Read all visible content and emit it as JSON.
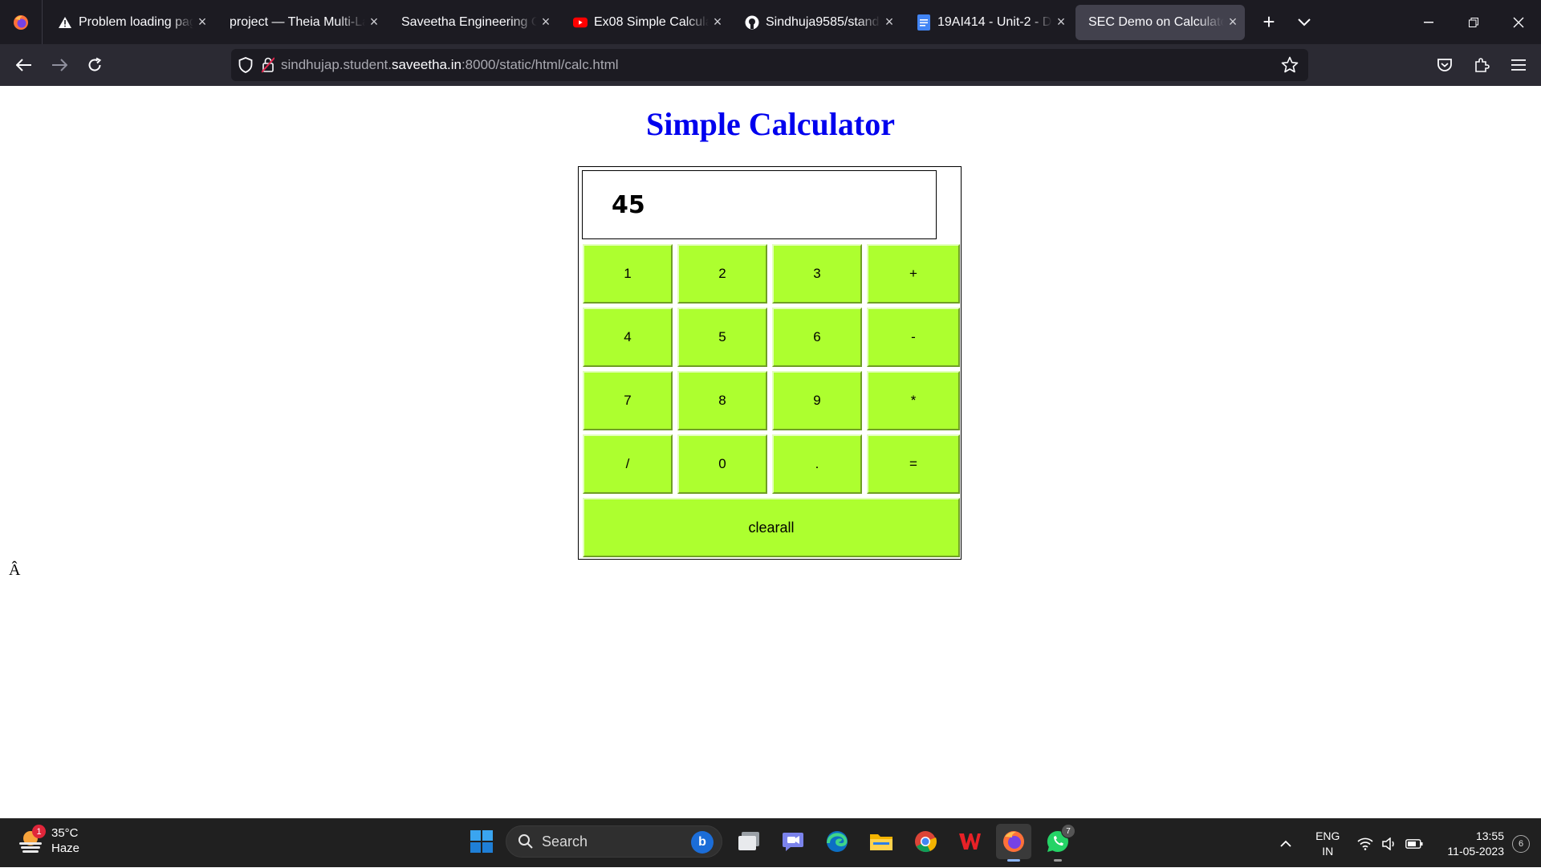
{
  "browser": {
    "tabs": [
      {
        "title": "Problem loading page",
        "icon": "warning-icon",
        "active": false
      },
      {
        "title": "project — Theia Multi-Language",
        "icon": "none",
        "active": false
      },
      {
        "title": "Saveetha Engineering College",
        "icon": "none",
        "active": false
      },
      {
        "title": "Ex08 Simple Calculator",
        "icon": "youtube-icon",
        "active": false
      },
      {
        "title": "Sindhuja9585/standard",
        "icon": "github-icon",
        "active": false
      },
      {
        "title": "19AI414 - Unit-2 - Django",
        "icon": "docs-icon",
        "active": false
      },
      {
        "title": "SEC Demo on Calculator",
        "icon": "none",
        "active": true
      }
    ],
    "url": {
      "prefix": "sindhujap.student.",
      "host": "saveetha.in",
      "suffix": ":8000/static/html/calc.html"
    }
  },
  "page": {
    "heading": "Simple Calculator",
    "heading_color": "#0000ee",
    "display_value": "45",
    "button_color": "#adff2f",
    "buttons": [
      [
        "1",
        "2",
        "3",
        "+"
      ],
      [
        "4",
        "5",
        "6",
        "-"
      ],
      [
        "7",
        "8",
        "9",
        "*"
      ],
      [
        "/",
        "0",
        ".",
        "="
      ]
    ],
    "clear_label": "clearall",
    "stray_text": "Â"
  },
  "taskbar": {
    "weather": {
      "temp": "35°C",
      "condition": "Haze",
      "badge": "1"
    },
    "search_placeholder": "Search",
    "apps": [
      "task-view-icon",
      "teams-chat-icon",
      "edge-icon",
      "file-explorer-icon",
      "chrome-icon",
      "wps-office-icon",
      "firefox-icon",
      "whatsapp-icon"
    ],
    "whatsapp_badge": "7",
    "lang": {
      "line1": "ENG",
      "line2": "IN"
    },
    "time": "13:55",
    "date": "11-05-2023",
    "notifications": "6"
  }
}
